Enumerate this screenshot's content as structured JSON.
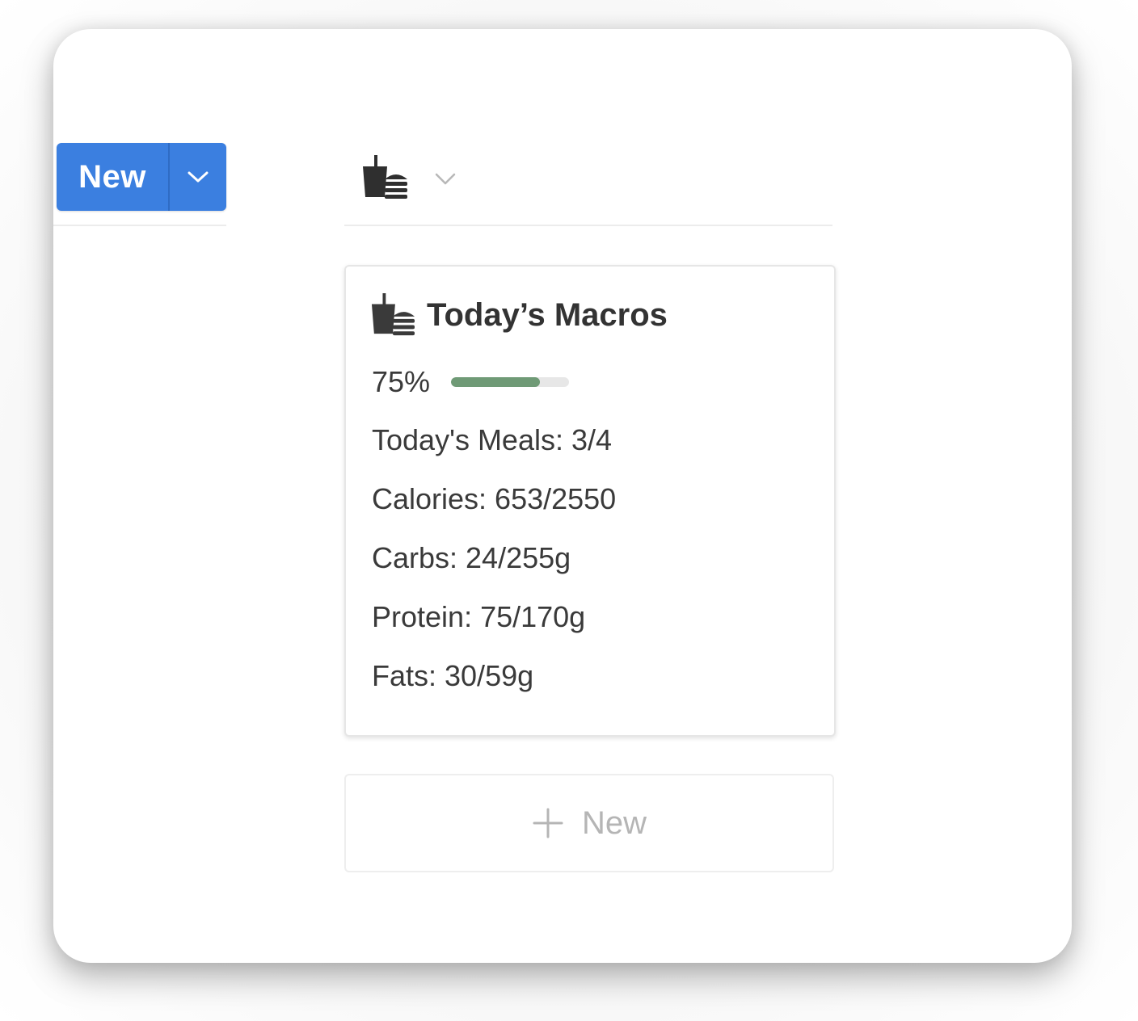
{
  "toolbar": {
    "new_label": "New"
  },
  "column": {
    "icon": "meal-icon"
  },
  "card": {
    "title": "Today’s Macros",
    "icon": "meal-icon",
    "progress_label": "75%",
    "progress_value": 0.75,
    "meals": "Today's Meals: 3/4",
    "calories": "Calories: 653/2550",
    "carbs": "Carbs: 24/255g",
    "protein": "Protein: 75/170g",
    "fats": "Fats: 30/59g"
  },
  "add_new": {
    "label": "New"
  },
  "colors": {
    "primary": "#3b7fe0",
    "progress": "#6f9a76",
    "text": "#333333"
  }
}
